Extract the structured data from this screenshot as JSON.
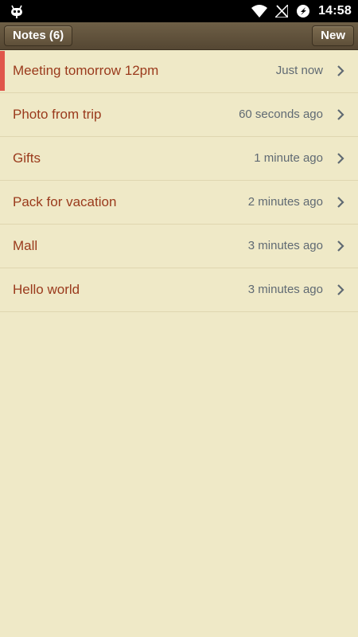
{
  "status_bar": {
    "time": "14:58",
    "icons": [
      "android-debug-icon",
      "wifi-icon",
      "no-signal-icon",
      "sync-icon"
    ]
  },
  "toolbar": {
    "notes_label": "Notes (6)",
    "new_label": "New"
  },
  "notes": [
    {
      "title": "Meeting tomorrow 12pm",
      "time": "Just now",
      "selected": true
    },
    {
      "title": "Photo from trip",
      "time": "60 seconds ago",
      "selected": false
    },
    {
      "title": "Gifts",
      "time": "1 minute ago",
      "selected": false
    },
    {
      "title": "Pack for vacation",
      "time": "2 minutes ago",
      "selected": false
    },
    {
      "title": "Mall",
      "time": "3 minutes ago",
      "selected": false
    },
    {
      "title": "Hello world",
      "time": "3 minutes ago",
      "selected": false
    }
  ],
  "colors": {
    "background": "#efe9c7",
    "title_text": "#9a3a1c",
    "time_text": "#606a73",
    "selection_marker": "#e0564b",
    "toolbar": "#5e4f39"
  }
}
